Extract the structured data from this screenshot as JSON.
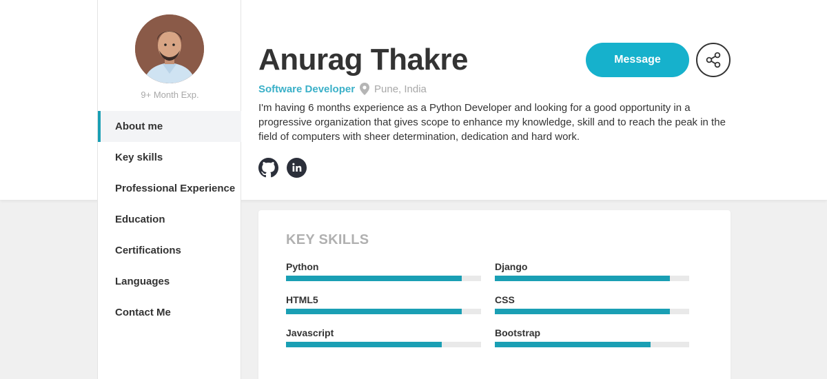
{
  "profile": {
    "name": "Anurag Thakre",
    "role": "Software Developer",
    "location": "Pune, India",
    "experience": "9+ Month Exp.",
    "about": "I'm having 6 months experience as a Python Developer and looking for a good opportunity in a progressive organization that gives scope to enhance my knowledge, skill and to reach the peak in the field of computers with sheer determination, dedication and hard work.",
    "avatar_icon": "profile-photo",
    "social_icons": [
      "github-icon",
      "linkedin-icon"
    ]
  },
  "actions": {
    "message_label": "Message",
    "share_icon": "share-icon"
  },
  "sidebar": {
    "items": [
      {
        "label": "About me",
        "active": true
      },
      {
        "label": "Key skills",
        "active": false
      },
      {
        "label": "Professional Experience",
        "active": false
      },
      {
        "label": "Education",
        "active": false
      },
      {
        "label": "Certifications",
        "active": false
      },
      {
        "label": "Languages",
        "active": false
      },
      {
        "label": "Contact Me",
        "active": false
      }
    ]
  },
  "key_skills": {
    "title": "KEY SKILLS",
    "skills": [
      {
        "name": "Python",
        "level": 0.9
      },
      {
        "name": "Django",
        "level": 0.9
      },
      {
        "name": "HTML5",
        "level": 0.9
      },
      {
        "name": "CSS",
        "level": 0.9
      },
      {
        "name": "Javascript",
        "level": 0.8
      },
      {
        "name": "Bootstrap",
        "level": 0.8
      }
    ]
  },
  "colors": {
    "accent": "#16b1cc",
    "bar_fill": "#1a9fb4",
    "role_text": "#3ab0c8",
    "muted_text": "#a8a8a8"
  }
}
